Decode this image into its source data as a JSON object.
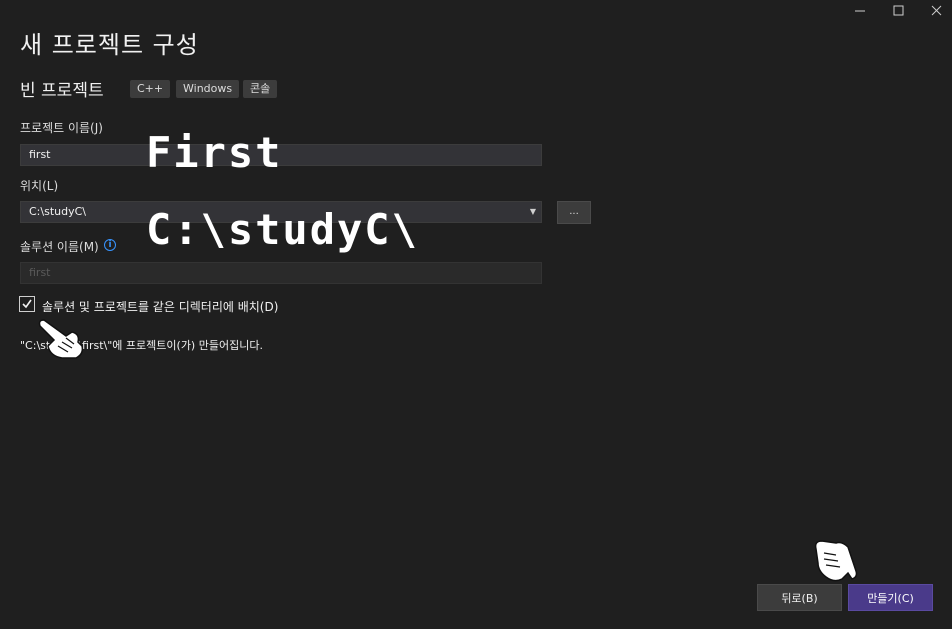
{
  "window": {
    "title": "새 프로젝트 구성",
    "controls": [
      "minimize-icon",
      "maximize-icon",
      "close-icon"
    ]
  },
  "template": {
    "name": "빈 프로젝트",
    "tags": [
      "C++",
      "Windows",
      "콘솔"
    ]
  },
  "project_name": {
    "label": "프로젝트 이름(J)",
    "value": "first"
  },
  "location": {
    "label": "위치(L)",
    "value": "C:\\studyC\\",
    "browse_label": "..."
  },
  "solution_name": {
    "label": "솔루션 이름(M)",
    "placeholder": "first"
  },
  "same_dir": {
    "label": "솔루션 및 프로젝트를 같은 디렉터리에 배치(D)",
    "checked": true
  },
  "path_note": "\"C:\\studyC\\first\\\"에 프로젝트이(가) 만들어집니다.",
  "annotations": {
    "name_hint": "First",
    "location_hint": "C:\\studyC\\"
  },
  "buttons": {
    "back": "뒤로(B)",
    "create": "만들기(C)"
  },
  "colors": {
    "background": "#1f1f1f",
    "accent": "#4a3a8a",
    "info": "#3794ff"
  }
}
